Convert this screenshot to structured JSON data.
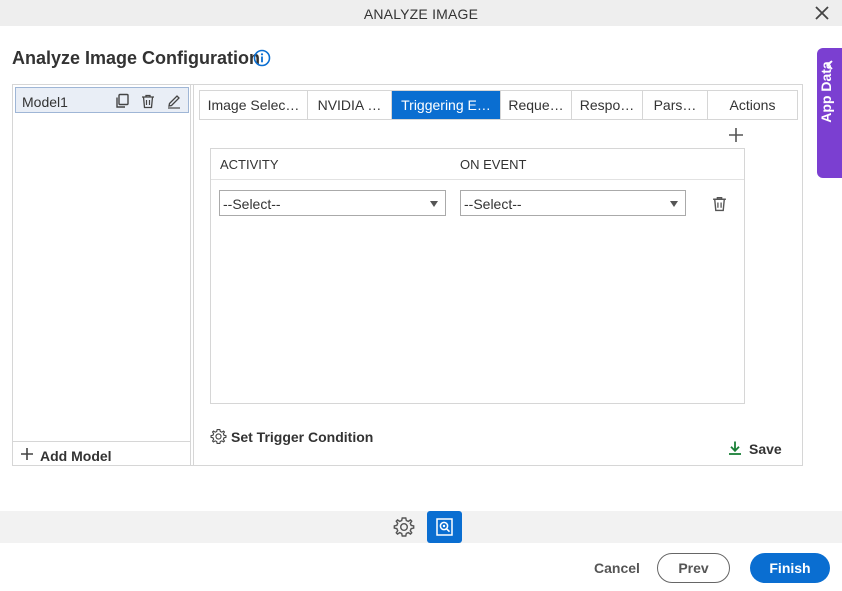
{
  "dialog": {
    "title": "ANALYZE IMAGE"
  },
  "page": {
    "title": "Analyze Image Configuration"
  },
  "app_data": {
    "label": "App Data"
  },
  "models": {
    "items": [
      {
        "name": "Model1"
      }
    ],
    "add_label": "Add Model"
  },
  "tabs": [
    {
      "label": "Image Selec…",
      "active": false
    },
    {
      "label": "NVIDIA …",
      "active": false
    },
    {
      "label": "Triggering E…",
      "active": true
    },
    {
      "label": "Reque…",
      "active": false
    },
    {
      "label": "Respo…",
      "active": false
    },
    {
      "label": "Pars…",
      "active": false
    },
    {
      "label": "Actions",
      "active": false
    }
  ],
  "grid": {
    "columns": [
      "ACTIVITY",
      "ON EVENT"
    ],
    "rows": [
      {
        "activity": "--Select--",
        "on_event": "--Select--"
      }
    ]
  },
  "trigger_condition_label": "Set Trigger Condition",
  "save_label": "Save",
  "footer": {
    "cancel": "Cancel",
    "prev": "Prev",
    "finish": "Finish"
  },
  "colors": {
    "accent": "#0a6ed1",
    "app_data_tab": "#7b3fd1",
    "save_icon": "#1a7f37"
  }
}
